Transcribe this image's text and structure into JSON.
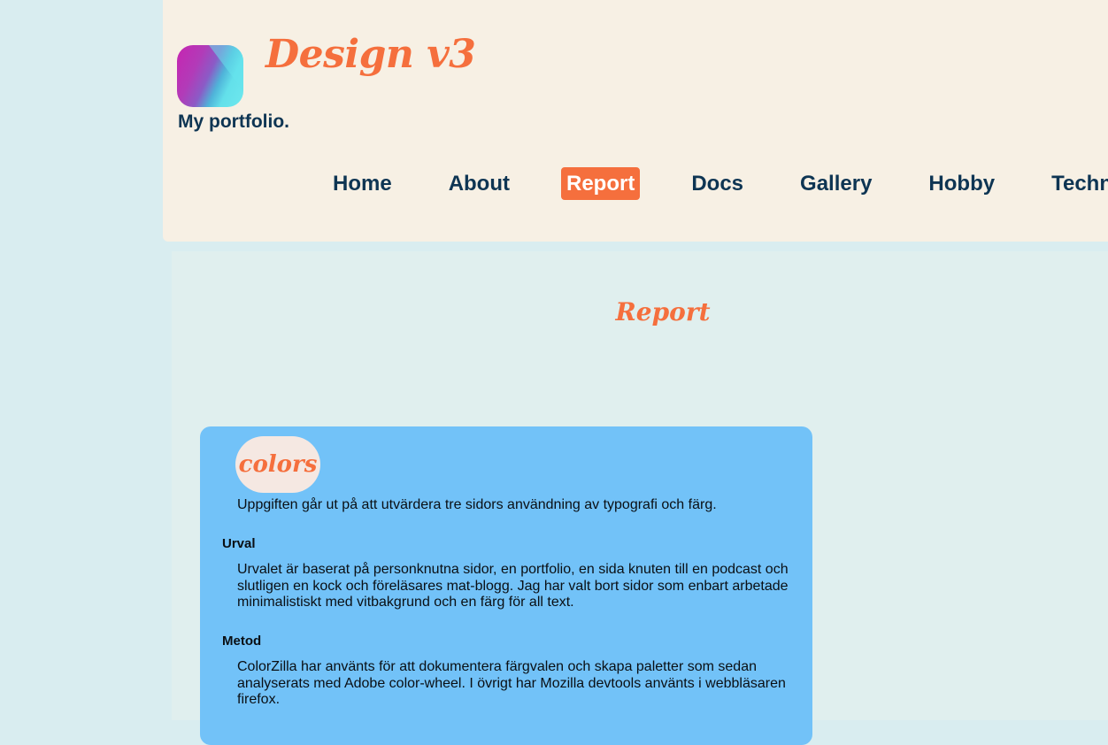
{
  "header": {
    "site_title": "Design v3",
    "tagline": "My portfolio."
  },
  "nav": {
    "items": [
      "Home",
      "About",
      "Report",
      "Docs",
      "Gallery",
      "Hobby",
      "Technolo"
    ],
    "active": "Report"
  },
  "main": {
    "page_heading": "Report",
    "card": {
      "pill_label": "colors",
      "intro": "Uppgiften går ut på att utvärdera tre sidors användning av typografi och färg.",
      "sections": [
        {
          "heading": "Urval",
          "text": "Urvalet är baserat på personknutna sidor, en portfolio, en sida knuten till en podcast och slutligen en kock och föreläsares mat-blogg. Jag har valt bort sidor som enbart arbetade minimalistiskt med vitbakgrund och en färg för all text."
        },
        {
          "heading": "Metod",
          "text": "ColorZilla har använts för att dokumentera färgvalen och skapa paletter som sedan analyserats med Adobe color-wheel. I övrigt har Mozilla devtools använts i webbläsaren firefox."
        }
      ]
    }
  },
  "colors": {
    "accent": "#f56f3d",
    "text_dark": "#0e3553",
    "header_bg": "#f7f0e4",
    "page_bg": "#d9edf0",
    "main_bg": "#e0efee",
    "card_bg": "#72c2f8",
    "pill_bg": "#f5e8e2"
  },
  "icons": {
    "logo": "gradient-logo-icon"
  }
}
